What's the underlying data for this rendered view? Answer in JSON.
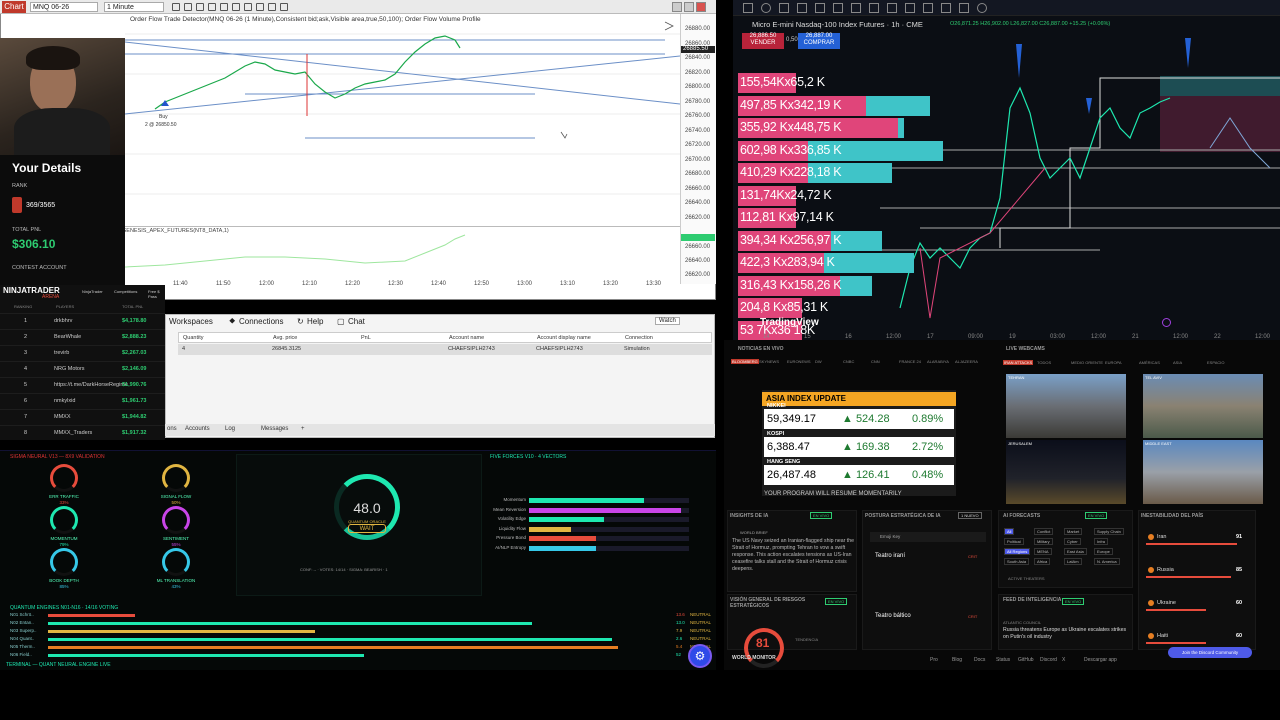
{
  "nt": {
    "badge": "Chart",
    "instrument": "MNQ 06-26",
    "interval": "1 Minute",
    "header": "Order Flow Trade Detector(MNQ 06-26 (1 Minute),Consistent bid;ask,Visible area,true,50,100); Order Flow Volume Profile",
    "buy_label": "Buy",
    "buy_detail": "2 @ 26850.50",
    "indicator_label": "GENESIS_APEX_FUTURES(NT8_DATA,1)",
    "price_ticks": [
      "26880.00",
      "26860.00",
      "26840.00",
      "26820.00",
      "26800.00",
      "26780.00",
      "26760.00",
      "26740.00",
      "26720.00",
      "26700.00",
      "26680.00",
      "26660.00",
      "26640.00",
      "26620.00"
    ],
    "price_tag": "26885.50",
    "ind_ticks": [
      "26660.00",
      "26640.00",
      "26620.00"
    ],
    "time_ticks": [
      "11:40",
      "11:50",
      "12:00",
      "12:10",
      "12:20",
      "12:30",
      "12:40",
      "12:50",
      "13:00",
      "13:10",
      "13:20",
      "13:30"
    ],
    "menu": [
      "Workspaces",
      "Connections",
      "Help",
      "Chat"
    ],
    "positions_headers": [
      "Quantity",
      "Avg. price",
      "PnL",
      "Account name",
      "Account display name",
      "Connection"
    ],
    "positions_row": [
      "4",
      "26845.3125",
      "",
      "CHAEFSIPLH2743",
      "CHAEFSIPLH2743",
      "Simulation"
    ],
    "bottom_tabs": [
      "Accounts",
      "Log",
      "Messages",
      "+"
    ],
    "positions_tab": "ons",
    "watch": "Watch"
  },
  "contest": {
    "title": "Your Details",
    "rank_label": "RANK",
    "rank_value": "369/3565",
    "pnl_label": "TOTAL PNL",
    "pnl_value": "$306.10",
    "account_label": "CONTEST ACCOUNT",
    "brand": "NINJATRADER",
    "brand_sub": "ARENA",
    "tabs": [
      "NinjaTrader",
      "Competitions",
      "Free $ Pass"
    ],
    "cols": [
      "RANKING",
      "PLAYERS",
      "TOTAL PNL"
    ],
    "rows": [
      {
        "rank": "1",
        "player": "drkbhrv",
        "pnl": "$4,178.80"
      },
      {
        "rank": "2",
        "player": "BearWhale",
        "pnl": "$2,888.23"
      },
      {
        "rank": "3",
        "player": "trevirb",
        "pnl": "$2,267.03"
      },
      {
        "rank": "4",
        "player": "NRG Motors",
        "pnl": "$2,146.09"
      },
      {
        "rank": "5",
        "player": "https://t.me/DarkHorseRegime",
        "pnl": "$1,990.76"
      },
      {
        "rank": "6",
        "player": "nmkylxid",
        "pnl": "$1,961.73"
      },
      {
        "rank": "7",
        "player": "MMXX",
        "pnl": "$1,944.82"
      },
      {
        "rank": "8",
        "player": "MMXX_Traders",
        "pnl": "$1,917.32"
      }
    ]
  },
  "tv": {
    "title": "Micro E-mini Nasdaq-100 Index Futures · 1h · CME",
    "ohlc": "O26,871.25 H26,902.00 L26,827.00 C26,887.00 +15.25 (+0.06%)",
    "sell_price": "26,886.50",
    "sell_label": "VENDER",
    "spread": "0,50",
    "buy_price": "26,887.00",
    "buy_label": "COMPRAR",
    "vp_labels": [
      "155,54Kx65,2 K",
      "497,85 Kx342,19 K",
      "355,92 Kx448,75 K",
      "602,98 Kx336,85 K",
      "410,29 Kx228,18 K",
      "131,74Kx24,72 K",
      "112,81 Kx97,14 K",
      "394,34 Kx256,97 K",
      "422,3 Kx283,94 K",
      "316,43 Kx158,26 K",
      "204,8 Kx85,31 K",
      "53 7Kx36 18K"
    ],
    "vp_pink": [
      0.18,
      0.6,
      0.52,
      0.64,
      0.48,
      0.18,
      0.18,
      0.45,
      0.55,
      0.42,
      0.2,
      0.2
    ],
    "vp_teal": [
      0.0,
      0.2,
      0.02,
      0.42,
      0.26,
      0.0,
      0.0,
      0.16,
      0.28,
      0.1,
      0.0,
      0.0
    ],
    "brand": "TradingView",
    "time_ticks": [
      "14",
      "15",
      "16",
      "12:00",
      "17",
      "09:00",
      "19",
      "03:00",
      "12:00",
      "21",
      "12:00",
      "22",
      "12:00"
    ]
  },
  "wm": {
    "news_label": "NOTICIAS EN VIVO",
    "news_tabs": [
      "BLOOMBERG",
      "SKYNEWS",
      "EURONEWS",
      "DW",
      "CNBC",
      "CNN",
      "FRANCE 24",
      "ALARABIYA",
      "ALJAZEERA"
    ],
    "asia_title": "ASIA INDEX UPDATE",
    "asia": [
      {
        "name": "NIKKEI",
        "value": "59,349.17",
        "chg": "524.28",
        "pct": "0.89%"
      },
      {
        "name": "KOSPI",
        "value": "6,388.47",
        "chg": "169.38",
        "pct": "2.72%"
      },
      {
        "name": "HANG SENG",
        "value": "26,487.48",
        "chg": "126.41",
        "pct": "0.48%"
      }
    ],
    "asia_footer": "YOUR PROGRAM WILL RESUME MOMENTARILY",
    "cams_label": "LIVE WEBCAMS",
    "cams_tabs": [
      "IRAN ATTACKS",
      "TODOS",
      "MEDIO ORIENTE",
      "EUROPA",
      "AMÉRICAS",
      "ASIA",
      "ESPACIO"
    ],
    "cam_labels": [
      "TEHRAN",
      "TEL AVIV",
      "JERUSALEM",
      "MIDDLE EAST"
    ],
    "insights_label": "INSIGHTS DE IA",
    "insights_badge": "EN VIVO",
    "insights_src": "WORLD BRIEF",
    "insights_text": "The US Navy seized an Iranian-flagged ship near the Strait of Hormuz, prompting Tehran to vow a swift response. This action escalates tensions as US-Iran ceasefire talks stall and the Strait of Hormuz crisis deepens.",
    "posture_label": "POSTURA ESTRATÉGICA DE IA",
    "posture_badge": "1 NUEVO",
    "posture_user": "Emoji Key",
    "posture_items": [
      {
        "name": "Teatro iraní",
        "tag": "CRIT"
      },
      {
        "name": "Teatro báltico",
        "tag": "CRIT"
      }
    ],
    "forecast_label": "AI FORECASTS",
    "forecast_badge": "EN VIVO",
    "forecast_tags": [
      "All",
      "Conflict",
      "Market",
      "Supply Chain",
      "Political",
      "Military",
      "Cyber",
      "Infra",
      "All Regions",
      "MENA",
      "East Asia",
      "Europe",
      "South Asia",
      "Africa",
      "LatAm",
      "N. America"
    ],
    "forecast_sub": "ACTIVE THEATERS",
    "instab_label": "INESTABILIDAD DEL PAÍS",
    "instab": [
      {
        "name": "Iran",
        "score": "91"
      },
      {
        "name": "Russia",
        "score": "85"
      },
      {
        "name": "Ukraine",
        "score": "60"
      },
      {
        "name": "Haiti",
        "score": "60"
      }
    ],
    "risk_label": "VISIÓN GENERAL DE RIESGOS ESTRATÉGICOS",
    "risk_badge": "EN VIVO",
    "risk_score": "81",
    "risk_trend": "TENDENCIA",
    "intel_label": "FEED DE INTELIGENCIA",
    "intel_badge": "EN VIVO",
    "intel_src": "ATLANTIC COUNCIL",
    "intel_text": "Russia threatens Europe as Ukraine escalates strikes on Putin's oil industry",
    "footer_brand": "WORLD MONITOR",
    "footer_links": [
      "Pro",
      "Blog",
      "Docs",
      "Status",
      "GitHub",
      "Discord",
      "X",
      "Descargar app"
    ],
    "discord": "Join the Discord Community"
  },
  "neural": {
    "header_left": "SIGMA NEURAL V13 — 8X9 VALIDATION",
    "gauges": [
      {
        "label": "ERR TRAFFIC",
        "val": "33%",
        "color": "#e74c3c"
      },
      {
        "label": "SIGNAL FLOW",
        "val": "50%",
        "color": "#e1b541"
      },
      {
        "label": "MOMENTUM",
        "val": "79%",
        "color": "#1ee8b0"
      },
      {
        "label": "SENTIMENT",
        "val": "55%",
        "color": "#c945e8"
      },
      {
        "label": "BOOK DEPTH",
        "val": "85%",
        "color": "#36c8e8"
      },
      {
        "label": "ML TRANSLATION",
        "val": "43%",
        "color": "#36c8e8"
      }
    ],
    "big_value": "48.0",
    "big_sub": "QUANTUM ORACLE",
    "big_signal": "WAIT",
    "big_foot": "CONF: -- · VOTES: 14/14 · SIGMA: BEARISH · 1",
    "forces_header": "FIVE FORCES V10 · 4 VECTORS",
    "forces": [
      {
        "label": "Momentum",
        "frac": 0.72,
        "color": "#1ee8b0"
      },
      {
        "label": "Mean Reversion",
        "frac": 0.95,
        "color": "#c945e8"
      },
      {
        "label": "Volatility Edge",
        "frac": 0.47,
        "color": "#1ee8b0"
      },
      {
        "label": "Liquidity Flow",
        "frac": 0.26,
        "color": "#e1b541"
      },
      {
        "label": "Pressure Bond",
        "frac": 0.42,
        "color": "#e74c3c"
      },
      {
        "label": "AI/NLP Entropy",
        "frac": 0.42,
        "color": "#36c8e8"
      }
    ],
    "quantum_header": "QUANTUM ENGINES N01-N16 · 14/16 VOTING",
    "quantum": [
      {
        "label": "N01 Schrö..",
        "frac": 0.14,
        "color": "#e74c3c",
        "val": "13.6",
        "tag": "NEUTRAL"
      },
      {
        "label": "N02 Entan..",
        "frac": 0.78,
        "color": "#1ee8b0",
        "val": "13.0",
        "tag": "NEUTRAL"
      },
      {
        "label": "N03 Superp..",
        "frac": 0.43,
        "color": "#e1b541",
        "val": "7.9",
        "tag": "NEUTRAL"
      },
      {
        "label": "N04 Quant..",
        "frac": 0.91,
        "color": "#1ee8b0",
        "val": "2.6",
        "tag": "NEUTRAL"
      },
      {
        "label": "N05 Therm..",
        "frac": 0.92,
        "color": "#e67e22",
        "val": "5.4",
        "tag": "NEUTRAL"
      },
      {
        "label": "N06 Field..",
        "frac": 0.51,
        "color": "#1ee8b0",
        "val": "52",
        "tag": "BEARISH"
      }
    ],
    "terminal": "TERMINAL — QUANT NEURAL ENGINE LIVE"
  }
}
